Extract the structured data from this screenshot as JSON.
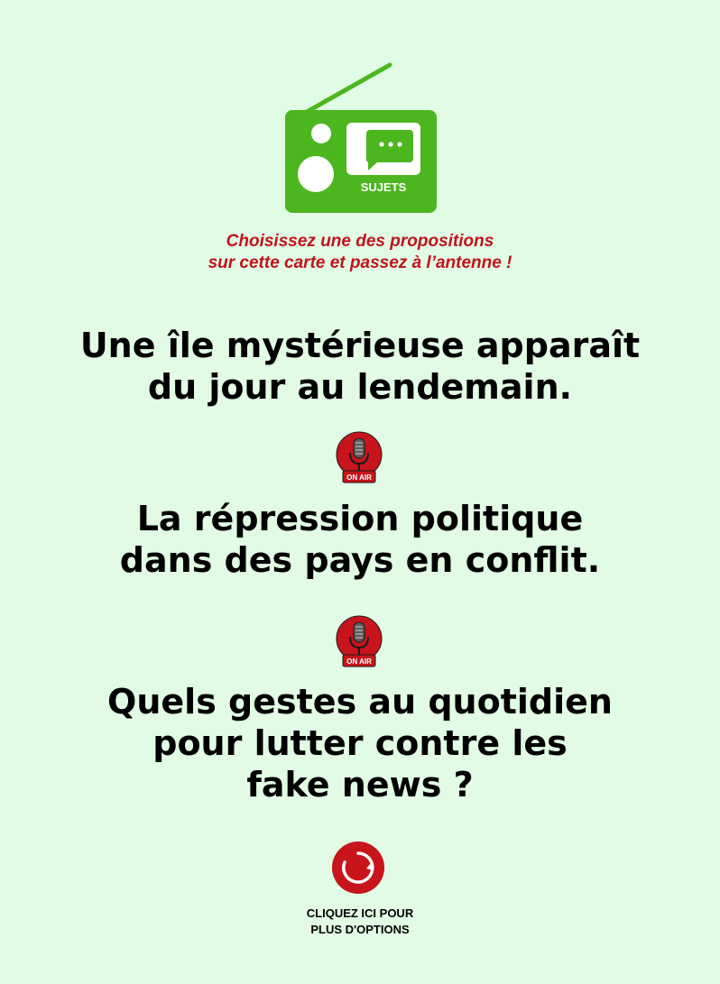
{
  "header": {
    "badge_label": "SUJETS",
    "instructions": [
      "Choisissez une des propositions",
      "sur cette carte et passez à l’antenne !"
    ]
  },
  "topics": [
    {
      "lines": [
        "Une île mystérieuse apparaît",
        "du jour au lendemain."
      ]
    },
    {
      "lines": [
        "La répression politique",
        "dans des pays en conflit."
      ]
    },
    {
      "lines": [
        "Quels gestes au quotidien",
        "pour lutter contre les",
        "fake news ?"
      ]
    }
  ],
  "onair_badge": {
    "label": "ON AIR",
    "icon": "microphone-icon"
  },
  "more_options": {
    "lines": [
      "CLIQUEZ ICI POUR",
      "PLUS D'OPTIONS"
    ],
    "icon": "refresh-icon"
  },
  "colors": {
    "background": "#e2fbe4",
    "radio_green": "#4cb61f",
    "accent_red": "#c0141b"
  }
}
